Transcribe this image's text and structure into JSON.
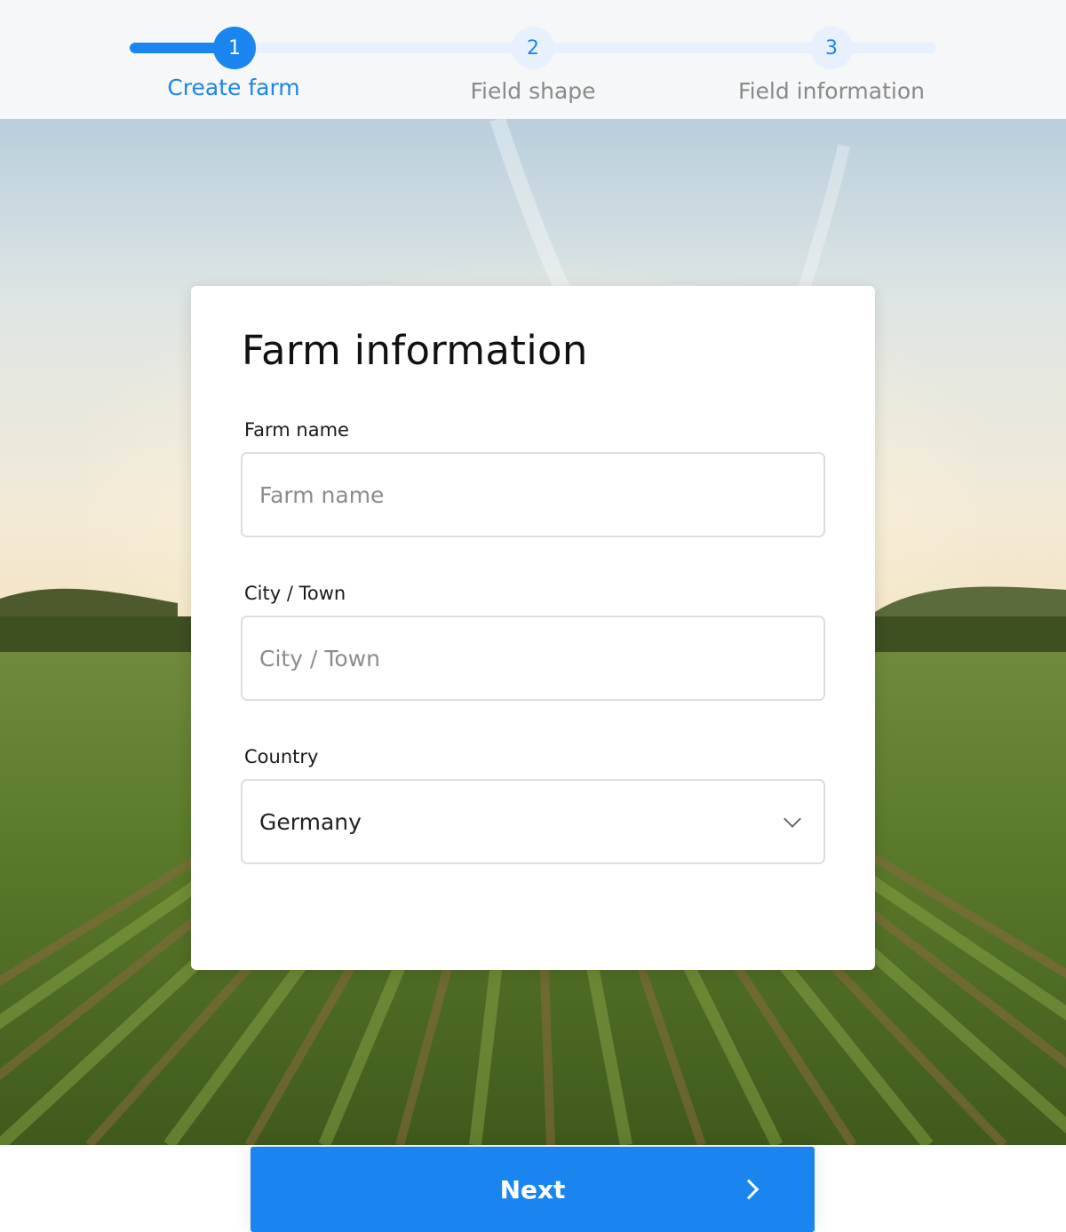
{
  "stepper": {
    "steps": [
      {
        "number": "1",
        "label": "Create farm"
      },
      {
        "number": "2",
        "label": "Field shape"
      },
      {
        "number": "3",
        "label": "Field information"
      }
    ],
    "current_step": 1
  },
  "form": {
    "title": "Farm information",
    "farm_name": {
      "label": "Farm name",
      "placeholder": "Farm name",
      "value": ""
    },
    "city": {
      "label": "City / Town",
      "placeholder": "City / Town",
      "value": ""
    },
    "country": {
      "label": "Country",
      "value": "Germany"
    }
  },
  "actions": {
    "next_label": "Next"
  },
  "colors": {
    "accent": "#1a85ef",
    "accent_light": "#e6f1fd",
    "header_bg": "#f6f7f8"
  },
  "icons": {
    "country_dropdown": "chevron-down-icon",
    "next": "chevron-right-icon"
  }
}
